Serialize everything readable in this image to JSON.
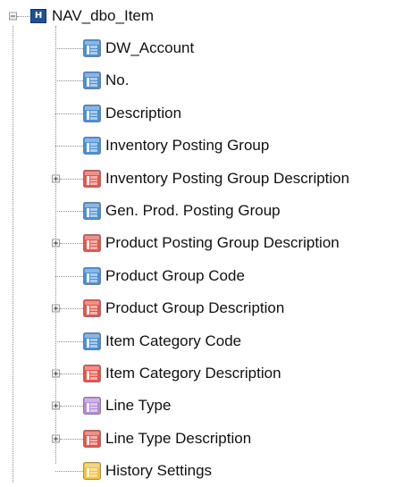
{
  "root": {
    "label": "NAV_dbo_Item",
    "icon_letter": "H",
    "expanded": true
  },
  "items": [
    {
      "label": "DW_Account",
      "icon": "blue-table-icon",
      "expandable": false
    },
    {
      "label": "No.",
      "icon": "blue-table-icon",
      "expandable": false
    },
    {
      "label": "Description",
      "icon": "blue-table-icon",
      "expandable": false
    },
    {
      "label": "Inventory Posting Group",
      "icon": "blue-table-icon",
      "expandable": false
    },
    {
      "label": "Inventory Posting Group Description",
      "icon": "red-table-icon",
      "expandable": true
    },
    {
      "label": "Gen. Prod. Posting Group",
      "icon": "blue-table-icon",
      "expandable": false
    },
    {
      "label": "Product Posting Group Description",
      "icon": "red-table-icon",
      "expandable": true
    },
    {
      "label": "Product Group Code",
      "icon": "blue-table-icon",
      "expandable": false
    },
    {
      "label": "Product Group Description",
      "icon": "red-table-icon",
      "expandable": true
    },
    {
      "label": "Item Category Code",
      "icon": "blue-table-icon",
      "expandable": false
    },
    {
      "label": "Item Category Description",
      "icon": "red-table-icon",
      "expandable": true
    },
    {
      "label": "Line Type",
      "icon": "purple-table-icon",
      "expandable": true
    },
    {
      "label": "Line Type Description",
      "icon": "red-table-icon",
      "expandable": true
    },
    {
      "label": "History Settings",
      "icon": "yellow-table-icon",
      "expandable": false
    }
  ],
  "colors": {
    "blue": "#4a90d9",
    "red": "#e8554a",
    "purple": "#b58ad8",
    "yellow": "#f2c230"
  }
}
